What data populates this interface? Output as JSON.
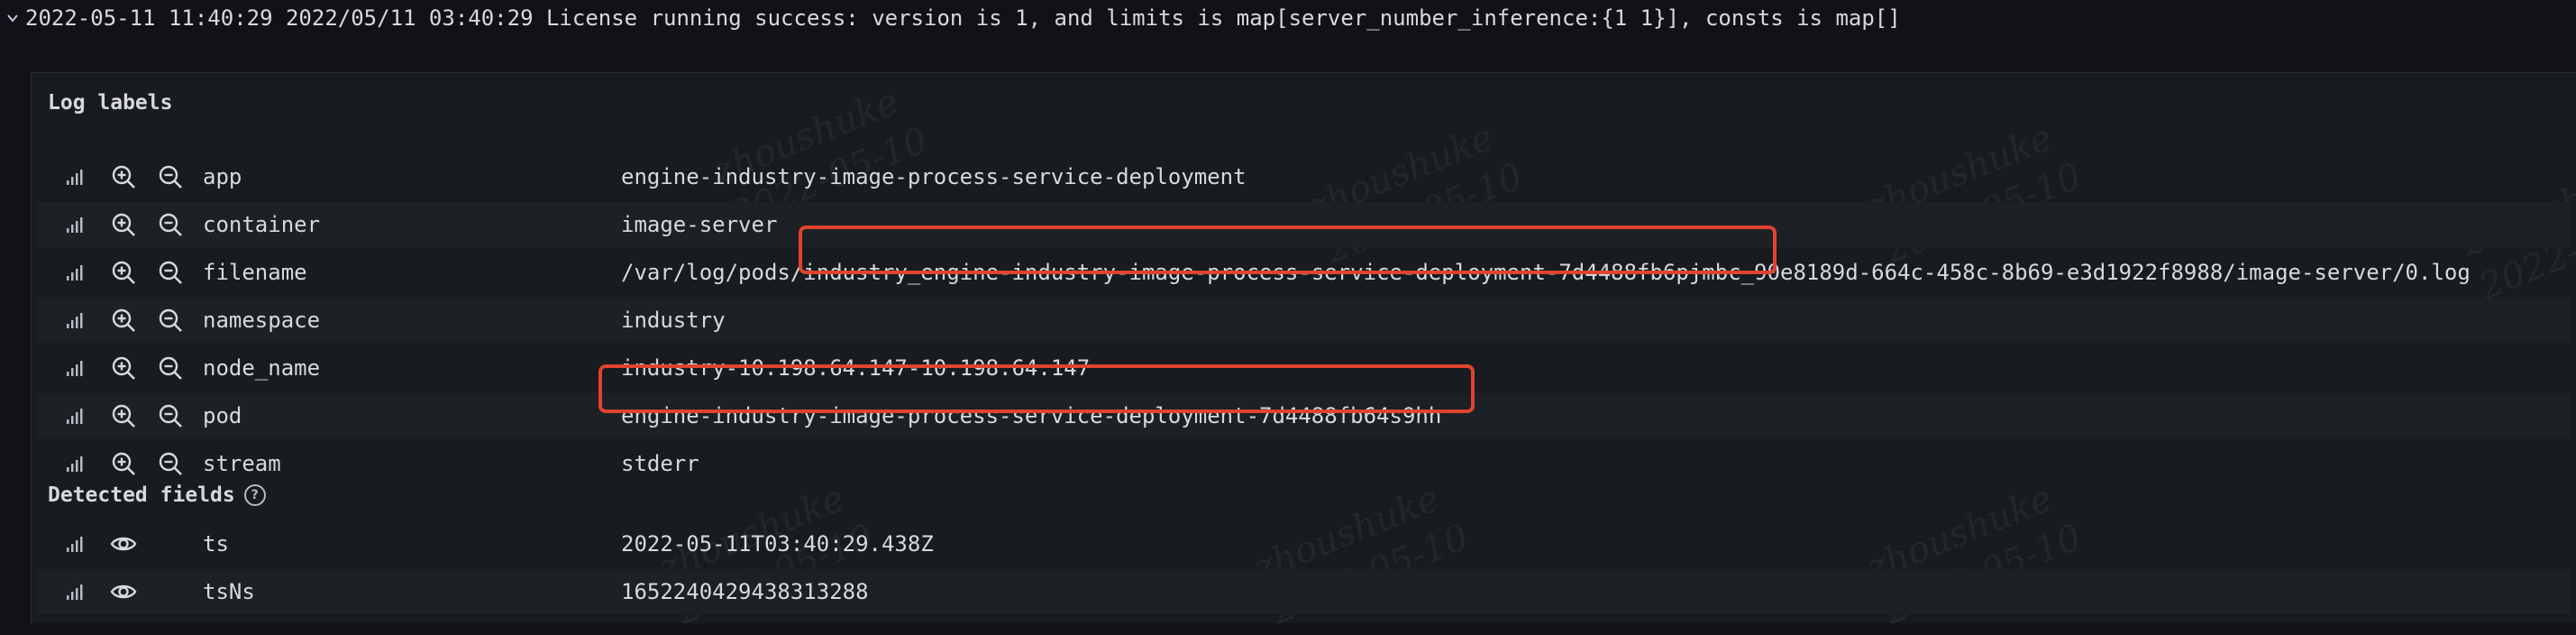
{
  "log_line": {
    "text": "2022-05-11 11:40:29 2022/05/11 03:40:29 License running success: version is 1, and limits is map[server_number_inference:{1 1}], consts is map[]"
  },
  "log_labels": {
    "title": "Log labels",
    "rows": [
      {
        "key": "app",
        "value": "engine-industry-image-process-service-deployment"
      },
      {
        "key": "container",
        "value": "image-server"
      },
      {
        "key": "filename",
        "value_prefix": "/var/log/pods/",
        "value_highlight": "industry_engine-industry-image-process-service-deployment-7d4488fb6pjmbc_",
        "value_suffix": "90e8189d-664c-458c-8b69-e3d1922f8988/image-server/0.log"
      },
      {
        "key": "namespace",
        "value": "industry"
      },
      {
        "key": "node_name",
        "value": "industry-10.198.64.147-10.198.64.147"
      },
      {
        "key": "pod",
        "value": "engine-industry-image-process-service-deployment-7d4488fb64s9hh"
      },
      {
        "key": "stream",
        "value": "stderr"
      }
    ]
  },
  "detected_fields": {
    "title": "Detected fields",
    "info_glyph": "?",
    "rows": [
      {
        "key": "ts",
        "value": "2022-05-11T03:40:29.438Z"
      },
      {
        "key": "tsNs",
        "value": "1652240429438313288"
      }
    ]
  },
  "watermark": {
    "name": "zhoushuke",
    "date": "2022-05-10"
  },
  "icons": {
    "stats": "bar-chart-icon",
    "filter_for": "zoom-in-icon",
    "filter_out": "zoom-out-icon",
    "toggle_field": "eye-icon",
    "expand": "chevron-down-icon"
  },
  "colors": {
    "background": "#111217",
    "panel": "#181b1f",
    "highlight_border": "#e0432e",
    "text": "#d8d9e0"
  }
}
